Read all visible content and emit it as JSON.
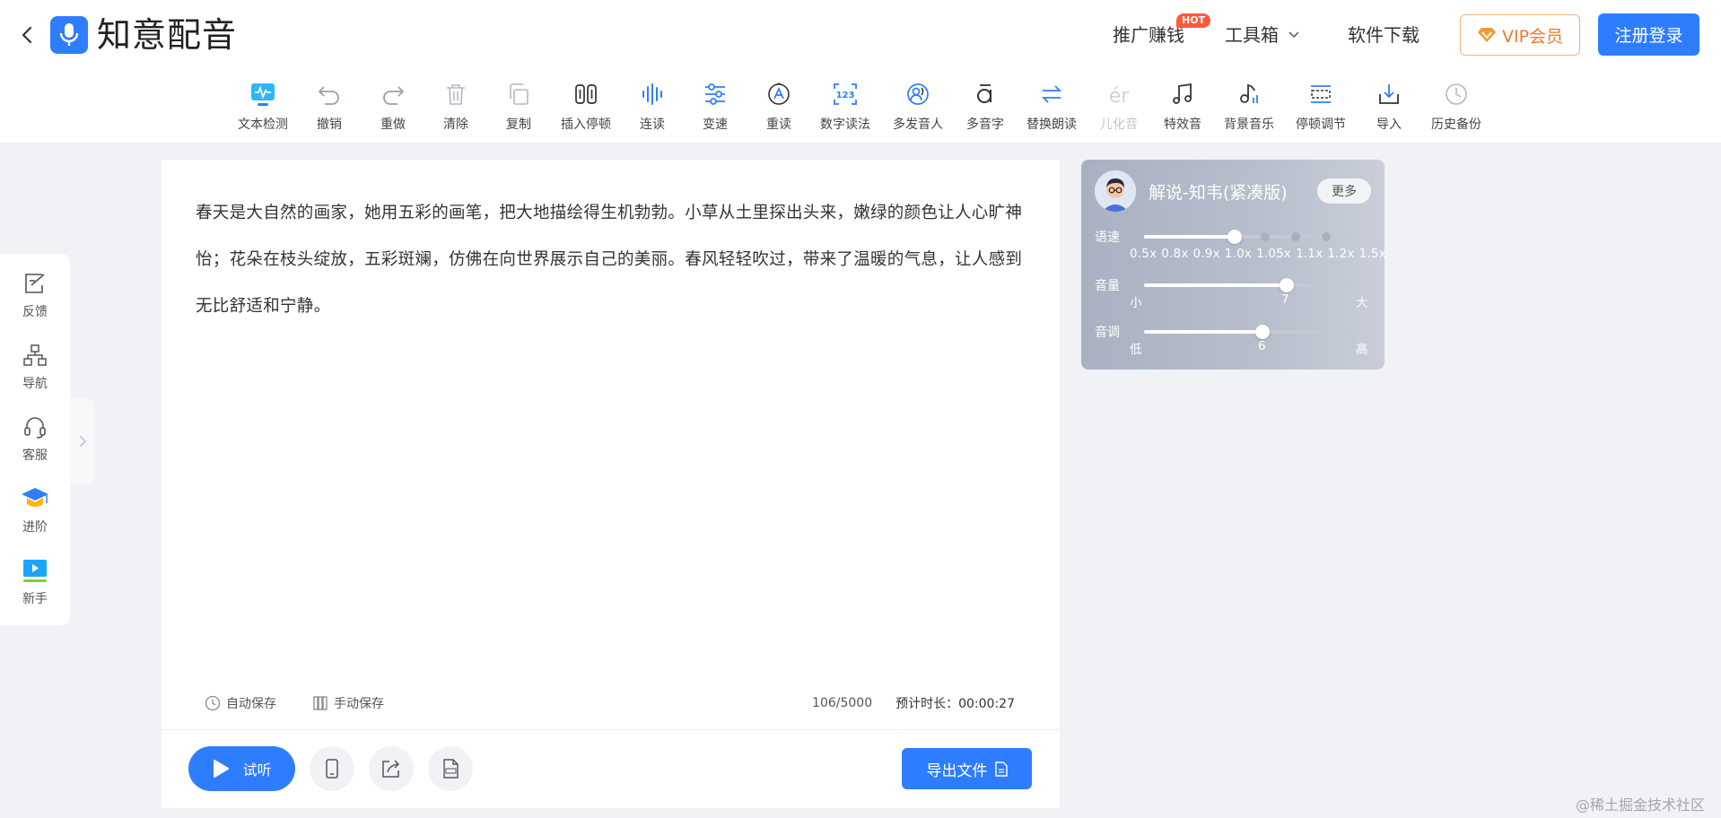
{
  "header": {
    "app_name": "知意配音",
    "nav": {
      "promo": "推广赚钱",
      "hot_badge": "HOT",
      "toolbox": "工具箱",
      "download": "软件下载"
    },
    "vip_label": "VIP会员",
    "login_label": "注册登录"
  },
  "toolbar": {
    "items": [
      {
        "label": "文本检测",
        "icon": "text-check-icon"
      },
      {
        "label": "撤销",
        "icon": "undo-icon"
      },
      {
        "label": "重做",
        "icon": "redo-icon"
      },
      {
        "label": "清除",
        "icon": "trash-icon"
      },
      {
        "label": "复制",
        "icon": "copy-icon"
      },
      {
        "label": "插入停顿",
        "icon": "pause-insert-icon"
      },
      {
        "label": "连读",
        "icon": "liaison-icon"
      },
      {
        "label": "变速",
        "icon": "speed-sliders-icon"
      },
      {
        "label": "重读",
        "icon": "stress-icon"
      },
      {
        "label": "数字读法",
        "icon": "number-reading-icon"
      },
      {
        "label": "多发音人",
        "icon": "multi-speaker-icon"
      },
      {
        "label": "多音字",
        "icon": "polyphone-icon"
      },
      {
        "label": "替换朗读",
        "icon": "replace-reading-icon"
      },
      {
        "label": "儿化音",
        "icon": "er-sound-icon"
      },
      {
        "label": "特效音",
        "icon": "music-note-icon"
      },
      {
        "label": "背景音乐",
        "icon": "bgm-icon"
      },
      {
        "label": "停顿调节",
        "icon": "pause-adjust-icon"
      },
      {
        "label": "导入",
        "icon": "import-icon"
      },
      {
        "label": "历史备份",
        "icon": "history-clock-icon"
      }
    ]
  },
  "sidebar": {
    "items": [
      {
        "label": "反馈",
        "icon": "feedback-icon"
      },
      {
        "label": "导航",
        "icon": "sitemap-icon"
      },
      {
        "label": "客服",
        "icon": "headset-icon"
      },
      {
        "label": "进阶",
        "icon": "graduation-cap-icon"
      },
      {
        "label": "新手",
        "icon": "video-play-icon"
      }
    ]
  },
  "editor": {
    "text": "春天是大自然的画家，她用五彩的画笔，把大地描绘得生机勃勃。小草从土里探出头来，嫩绿的颜色让人心旷神怡；花朵在枝头绽放，五彩斑斓，仿佛在向世界展示自己的美丽。春风轻轻吹过，带来了温暖的气息，让人感到无比舒适和宁静。",
    "auto_save": "自动保存",
    "manual_save": "手动保存",
    "char_count": "106/5000",
    "duration_label": "预计时长：00:00:27",
    "play_label": "试听",
    "export_label": "导出文件"
  },
  "voice_panel": {
    "voice_name": "解说-知韦(紧凑版)",
    "more_label": "更多",
    "speed": {
      "label": "语速",
      "ticks": [
        "0.5x",
        "0.8x",
        "0.9x",
        "1.0x",
        "1.05x",
        "1.1x",
        "1.2x",
        "1.5x"
      ],
      "selected": "1.0x"
    },
    "volume": {
      "label": "音量",
      "min_label": "小",
      "value": "7",
      "max_label": "大"
    },
    "pitch": {
      "label": "音调",
      "min_label": "低",
      "value": "6",
      "max_label": "高"
    }
  },
  "watermark": "@稀土掘金技术社区",
  "colors": {
    "accent": "#2f7dff",
    "vip": "#ee7a2c",
    "hot": "#ff5a3c",
    "panel": "#b6bdcb"
  }
}
